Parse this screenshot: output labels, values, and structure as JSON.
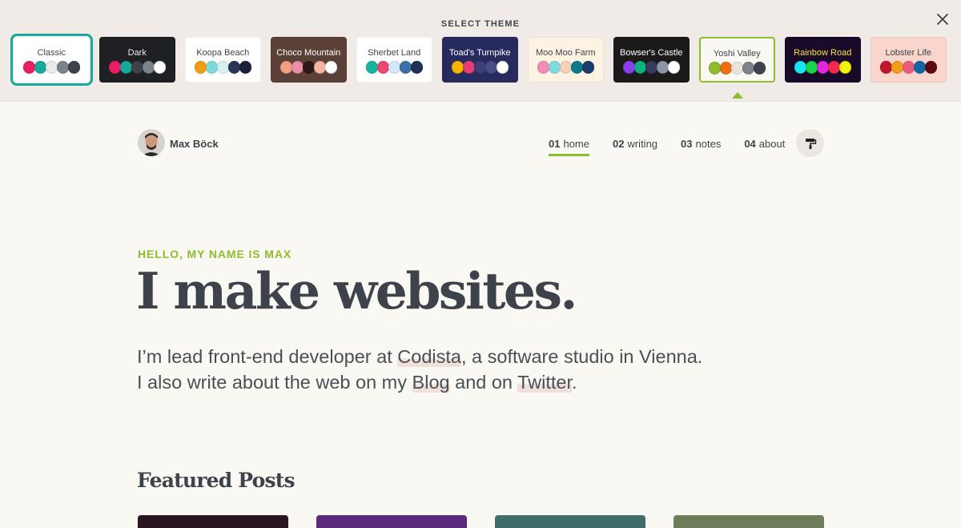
{
  "theme_picker": {
    "heading": "SELECT THEME",
    "close_icon": "close-icon",
    "themes": [
      {
        "name": "Classic",
        "bg": "#ffffff",
        "text": "#3e434b",
        "swatches": [
          "#e91e63",
          "#18a89c",
          "#eaeaea",
          "#7c838a",
          "#3e434b"
        ],
        "selected": true
      },
      {
        "name": "Dark",
        "bg": "#1f2023",
        "text": "#eeeeee",
        "swatches": [
          "#e91e63",
          "#18a89c",
          "#3e434b",
          "#7c838a",
          "#ffffff"
        ]
      },
      {
        "name": "Koopa Beach",
        "bg": "#ffffff",
        "text": "#3e434b",
        "swatches": [
          "#f39c12",
          "#7fdbda",
          "#d6f0ef",
          "#2c3558",
          "#1a1f3c"
        ]
      },
      {
        "name": "Choco Mountain",
        "bg": "#5b4038",
        "text": "#ffffff",
        "swatches": [
          "#f2a083",
          "#e98fa6",
          "#2c1a16",
          "#f4b6a2",
          "#ffffff"
        ]
      },
      {
        "name": "Sherbet Land",
        "bg": "#ffffff",
        "text": "#3e434b",
        "swatches": [
          "#16b5a3",
          "#e84a6f",
          "#d7e6f8",
          "#3d6fa8",
          "#1c3355"
        ]
      },
      {
        "name": "Toad's Turnpike",
        "bg": "#272a5c",
        "text": "#ffffff",
        "swatches": [
          "#f7b500",
          "#ea3d78",
          "#3d3f78",
          "#4a4d86",
          "#ffffff"
        ]
      },
      {
        "name": "Moo Moo Farm",
        "bg": "#fdf3e3",
        "text": "#3e434b",
        "swatches": [
          "#f48bb5",
          "#7fdbda",
          "#f7d2bb",
          "#0d7b8a",
          "#1c3a6b"
        ]
      },
      {
        "name": "Bowser's Castle",
        "bg": "#1a1a1a",
        "text": "#ffffff",
        "swatches": [
          "#8a3ff0",
          "#0fb081",
          "#383c5c",
          "#8c96a7",
          "#ffffff"
        ]
      },
      {
        "name": "Yoshi Valley",
        "bg": "#f9f8f3",
        "text": "#3e434b",
        "swatches": [
          "#8fbb2f",
          "#ee6e14",
          "#e8e3dd",
          "#7c838a",
          "#3e434b"
        ],
        "hovered": true
      },
      {
        "name": "Rainbow Road",
        "bg": "#180a28",
        "text": "#f7e23a",
        "swatches": [
          "#18e6f0",
          "#19d44a",
          "#e026e0",
          "#f22b4a",
          "#f2f20d"
        ]
      },
      {
        "name": "Lobster Life",
        "bg": "#f9d5cc",
        "text": "#3e434b",
        "swatches": [
          "#c0152a",
          "#f29e1b",
          "#ec5a7e",
          "#1467a6",
          "#5c0a12"
        ]
      }
    ]
  },
  "header": {
    "avatar_icon": "avatar-photo",
    "site_name": "Max Böck",
    "nav": [
      {
        "num": "01",
        "label": "home",
        "active": true
      },
      {
        "num": "02",
        "label": "writing"
      },
      {
        "num": "03",
        "label": "notes"
      },
      {
        "num": "04",
        "label": "about"
      }
    ],
    "theme_toggle_icon": "paint-roller-icon"
  },
  "hero": {
    "eyebrow": "HELLO, MY NAME IS MAX",
    "headline": "I make websites.",
    "line1_pre": "I’m lead front-end developer at ",
    "line1_link": "Codista",
    "line1_post": ", a software studio in Vienna.",
    "line2_pre": "I also write about the web on my ",
    "line2_link1": "Blog",
    "line2_mid": " and on ",
    "line2_link2": "Twitter",
    "line2_post": "."
  },
  "featured": {
    "title": "Featured Posts",
    "cards": [
      {
        "color": "#2a1620"
      },
      {
        "color": "#5a2b7a"
      },
      {
        "color": "#3f6e6a"
      },
      {
        "color": "#6e7d5a"
      }
    ]
  }
}
